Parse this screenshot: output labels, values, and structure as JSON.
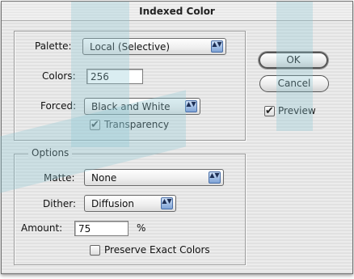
{
  "dialog": {
    "title": "Indexed Color"
  },
  "palette_group": {
    "palette": {
      "label": "Palette:",
      "value": "Local (Selective)"
    },
    "colors": {
      "label": "Colors:",
      "value": "256"
    },
    "forced": {
      "label": "Forced:",
      "value": "Black and White"
    },
    "transparency": {
      "label": "Transparency",
      "checked": true
    }
  },
  "options_group": {
    "title": "Options",
    "matte": {
      "label": "Matte:",
      "value": "None"
    },
    "dither": {
      "label": "Dither:",
      "value": "Diffusion"
    },
    "amount": {
      "label": "Amount:",
      "value": "75",
      "unit": "%"
    },
    "preserve": {
      "label": "Preserve Exact Colors",
      "checked": false
    }
  },
  "buttons": {
    "ok": "OK",
    "cancel": "Cancel"
  },
  "preview": {
    "label": "Preview",
    "checked": true
  },
  "icons": {
    "check": "✔",
    "popup_arrows": "▲▼"
  },
  "colors": {
    "accent": "#7ea3d6",
    "watermark": "#8fc9d6"
  }
}
